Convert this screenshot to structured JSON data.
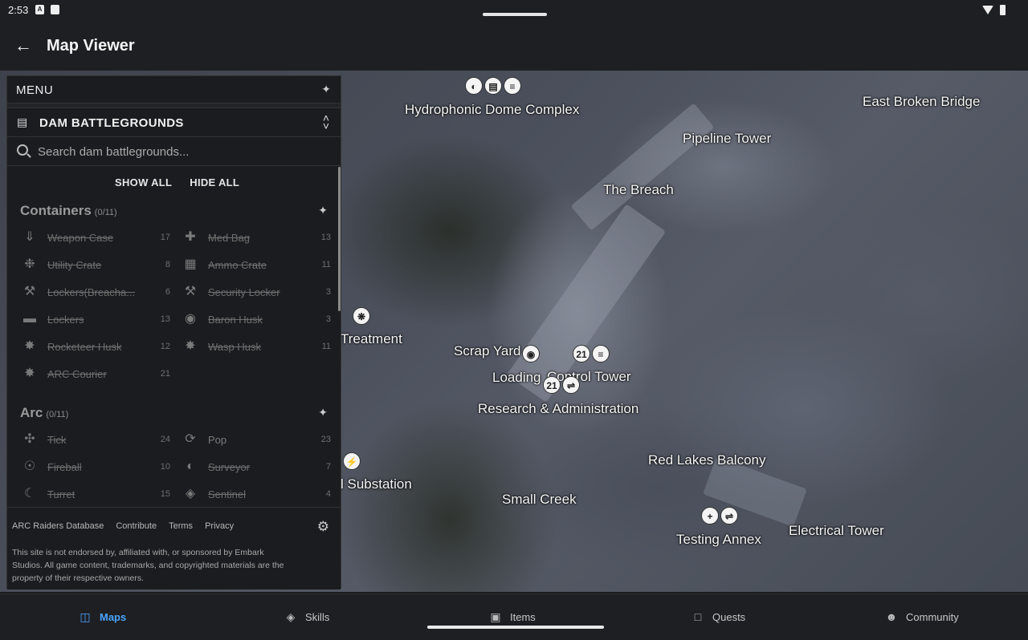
{
  "status": {
    "time": "2:53"
  },
  "appbar": {
    "title": "Map Viewer"
  },
  "panel": {
    "menu_label": "MENU",
    "map_name": "DAM BATTLEGROUNDS",
    "search_placeholder": "Search dam battlegrounds...",
    "show_all": "SHOW ALL",
    "hide_all": "HIDE ALL",
    "containers": {
      "title": "Containers",
      "count": "(0/11)",
      "items": [
        {
          "label": "Weapon Case",
          "count": "17",
          "icon": "weapon-case-icon"
        },
        {
          "label": "Med Bag",
          "count": "13",
          "icon": "med-bag-icon"
        },
        {
          "label": "Utility Crate",
          "count": "8",
          "icon": "utility-crate-icon"
        },
        {
          "label": "Ammo Crate",
          "count": "11",
          "icon": "ammo-crate-icon"
        },
        {
          "label": "Lockers(Breacha...",
          "count": "6",
          "icon": "pickaxe-icon"
        },
        {
          "label": "Security Locker",
          "count": "3",
          "icon": "pickaxe-icon"
        },
        {
          "label": "Lockers",
          "count": "13",
          "icon": "locker-icon"
        },
        {
          "label": "Baron Husk",
          "count": "3",
          "icon": "pin-icon"
        },
        {
          "label": "Rocketeer Husk",
          "count": "12",
          "icon": "husk-icon"
        },
        {
          "label": "Wasp Husk",
          "count": "11",
          "icon": "husk-icon"
        },
        {
          "label": "ARC Courier",
          "count": "21",
          "icon": "husk-icon"
        }
      ]
    },
    "arc": {
      "title": "Arc",
      "count": "(0/11)",
      "items": [
        {
          "label": "Tick",
          "count": "24",
          "icon": "tick-icon"
        },
        {
          "label": "Pop",
          "count": "23",
          "icon": "pop-icon"
        },
        {
          "label": "Fireball",
          "count": "10",
          "icon": "fireball-icon"
        },
        {
          "label": "Surveyor",
          "count": "7",
          "icon": "surveyor-icon"
        },
        {
          "label": "Turret",
          "count": "15",
          "icon": "turret-icon"
        },
        {
          "label": "Sentinel",
          "count": "4",
          "icon": "sentinel-icon"
        }
      ]
    },
    "footer": {
      "links": [
        "ARC Raiders Database",
        "Contribute",
        "Terms",
        "Privacy"
      ],
      "disclaimer": "This site is not endorsed by, affiliated with, or sponsored by Embark Studios. All game content, trademarks, and copyrighted materials are the property of their respective owners."
    }
  },
  "map": {
    "locations": [
      "Hydrophonic Dome Complex",
      "East Broken Bridge",
      "Pipeline Tower",
      "The Breach",
      "Treatment",
      "Scrap Yard",
      "Loading",
      "Control Tower",
      "Research & Administration",
      "Red Lakes Balcony",
      "l Substation",
      "Small Creek",
      "Testing Annex",
      "Electrical Tower"
    ],
    "marker_labels": {
      "level": "21"
    }
  },
  "nav": {
    "items": [
      {
        "label": "Maps",
        "icon": "map-icon"
      },
      {
        "label": "Skills",
        "icon": "skills-icon"
      },
      {
        "label": "Items",
        "icon": "items-icon"
      },
      {
        "label": "Quests",
        "icon": "quests-icon"
      },
      {
        "label": "Community",
        "icon": "community-icon"
      }
    ]
  },
  "colors": {
    "accent": "#4aa3ff",
    "background": "#1b1c1f"
  }
}
